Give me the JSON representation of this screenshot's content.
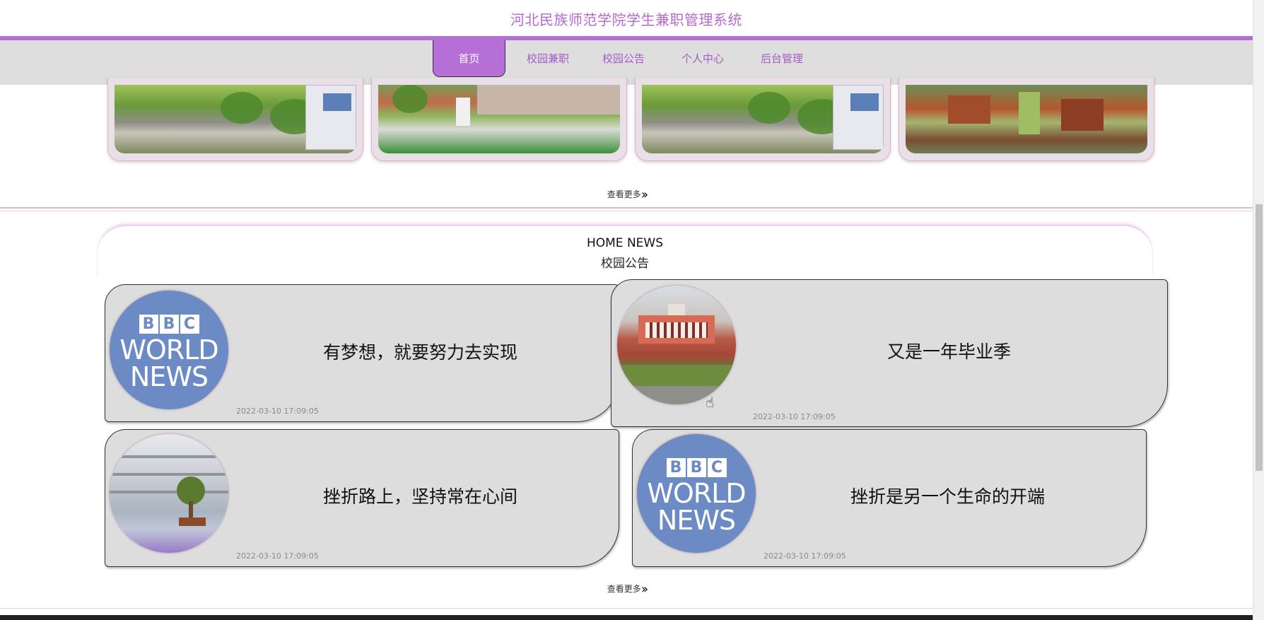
{
  "site": {
    "title": "河北民族师范学院学生兼职管理系统"
  },
  "nav": {
    "items": [
      {
        "label": "首页",
        "active": true
      },
      {
        "label": "校园兼职",
        "active": false
      },
      {
        "label": "校园公告",
        "active": false
      },
      {
        "label": "个人中心",
        "active": false
      },
      {
        "label": "后台管理",
        "active": false
      }
    ]
  },
  "gallery": {
    "more_label": "查看更多"
  },
  "news": {
    "header_en": "HOME NEWS",
    "header_cn": "校园公告",
    "more_label": "查看更多",
    "items": [
      {
        "title": "有梦想，就要努力去实现",
        "time": "2022-03-10 17:09:05",
        "image": "bbc-world-news-logo"
      },
      {
        "title": "又是一年毕业季",
        "time": "2022-03-10 17:09:05",
        "image": "campus-building-photo"
      },
      {
        "title": "挫折路上，坚持常在心间",
        "time": "2022-03-10 17:09:05",
        "image": "courtyard-photo"
      },
      {
        "title": "挫折是另一个生命的开端",
        "time": "2022-03-10 17:09:05",
        "image": "bbc-world-news-logo"
      }
    ],
    "logo_text": {
      "b1": "B",
      "b2": "B",
      "b3": "C",
      "line1": "WORLD",
      "line2": "NEWS"
    }
  },
  "colors": {
    "accent": "#b76fd8",
    "title": "#b56ad0",
    "card_bg": "#dddddd",
    "nav_bg": "#dedede"
  }
}
